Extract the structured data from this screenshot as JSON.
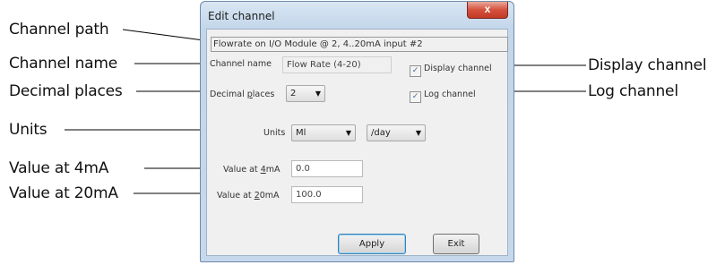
{
  "callouts": {
    "channel_path": "Channel path",
    "channel_name": "Channel name",
    "decimal_places": "Decimal places",
    "units": "Units",
    "value_4ma": "Value at 4mA",
    "value_20ma": "Value at 20mA",
    "display_channel": "Display channel",
    "log_channel": "Log channel"
  },
  "dialog": {
    "title": "Edit channel",
    "close_glyph": "x",
    "channel_path": "Flowrate on I/O Module @ 2, 4..20mA input #2",
    "channel_name_label": "Channel name",
    "channel_name_value": "Flow Rate (4-20)",
    "decimal_places_label": "Decimal places",
    "decimal_places_value": "2",
    "display_channel_label": "Display channel",
    "display_channel_checked": true,
    "log_channel_label": "Log channel",
    "log_channel_checked": true,
    "units_label": "Units",
    "units_value": "Ml",
    "units_per_value": "/day",
    "value_4ma_label": "Value at 4mA",
    "value_4ma": "0.0",
    "value_20ma_label": "Value at 20mA",
    "value_20ma": "100.0",
    "apply_label": "Apply",
    "exit_label": "Exit",
    "check_glyph": "✓",
    "dropdown_glyph": "▼"
  },
  "colors": {
    "window_frame": "#c6d8ec",
    "client_bg": "#f0f0f0",
    "close_button": "#d4513c",
    "default_button_border": "#3c7fb1"
  },
  "icons": [
    "close-icon",
    "checkbox-checked-icon",
    "dropdown-arrow-icon"
  ]
}
